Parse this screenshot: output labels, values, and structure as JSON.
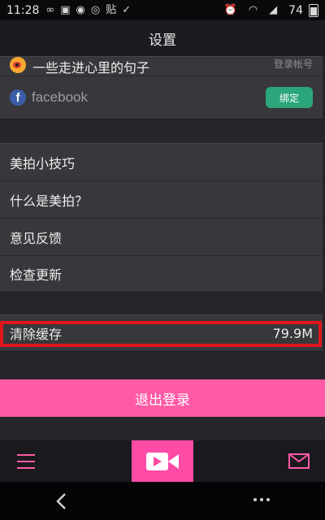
{
  "status_bar": {
    "time": "11:28",
    "battery": "74",
    "icons": [
      "infinity-icon",
      "image-icon",
      "qq-icon",
      "notification-icon",
      "tie-icon",
      "check-icon",
      "alarm-icon",
      "wifi-icon",
      "signal-icon",
      "battery-icon"
    ]
  },
  "header": {
    "title": "设置"
  },
  "accounts": {
    "weibo_name": "一些走进心里的句子",
    "weibo_action": "登录帐号",
    "facebook_label": "facebook",
    "bind_label": "绑定"
  },
  "info_menu": {
    "items": [
      {
        "label": "美拍小技巧"
      },
      {
        "label": "什么是美拍？"
      },
      {
        "label": "意见反馈"
      },
      {
        "label": "检查更新"
      }
    ]
  },
  "cache": {
    "label": "清除缓存",
    "size": "79.9M"
  },
  "logout": {
    "label": "退出登录"
  },
  "colors": {
    "accent": "#ff5aa5",
    "bind_button": "#2aa67a",
    "highlight": "#e0161c"
  }
}
